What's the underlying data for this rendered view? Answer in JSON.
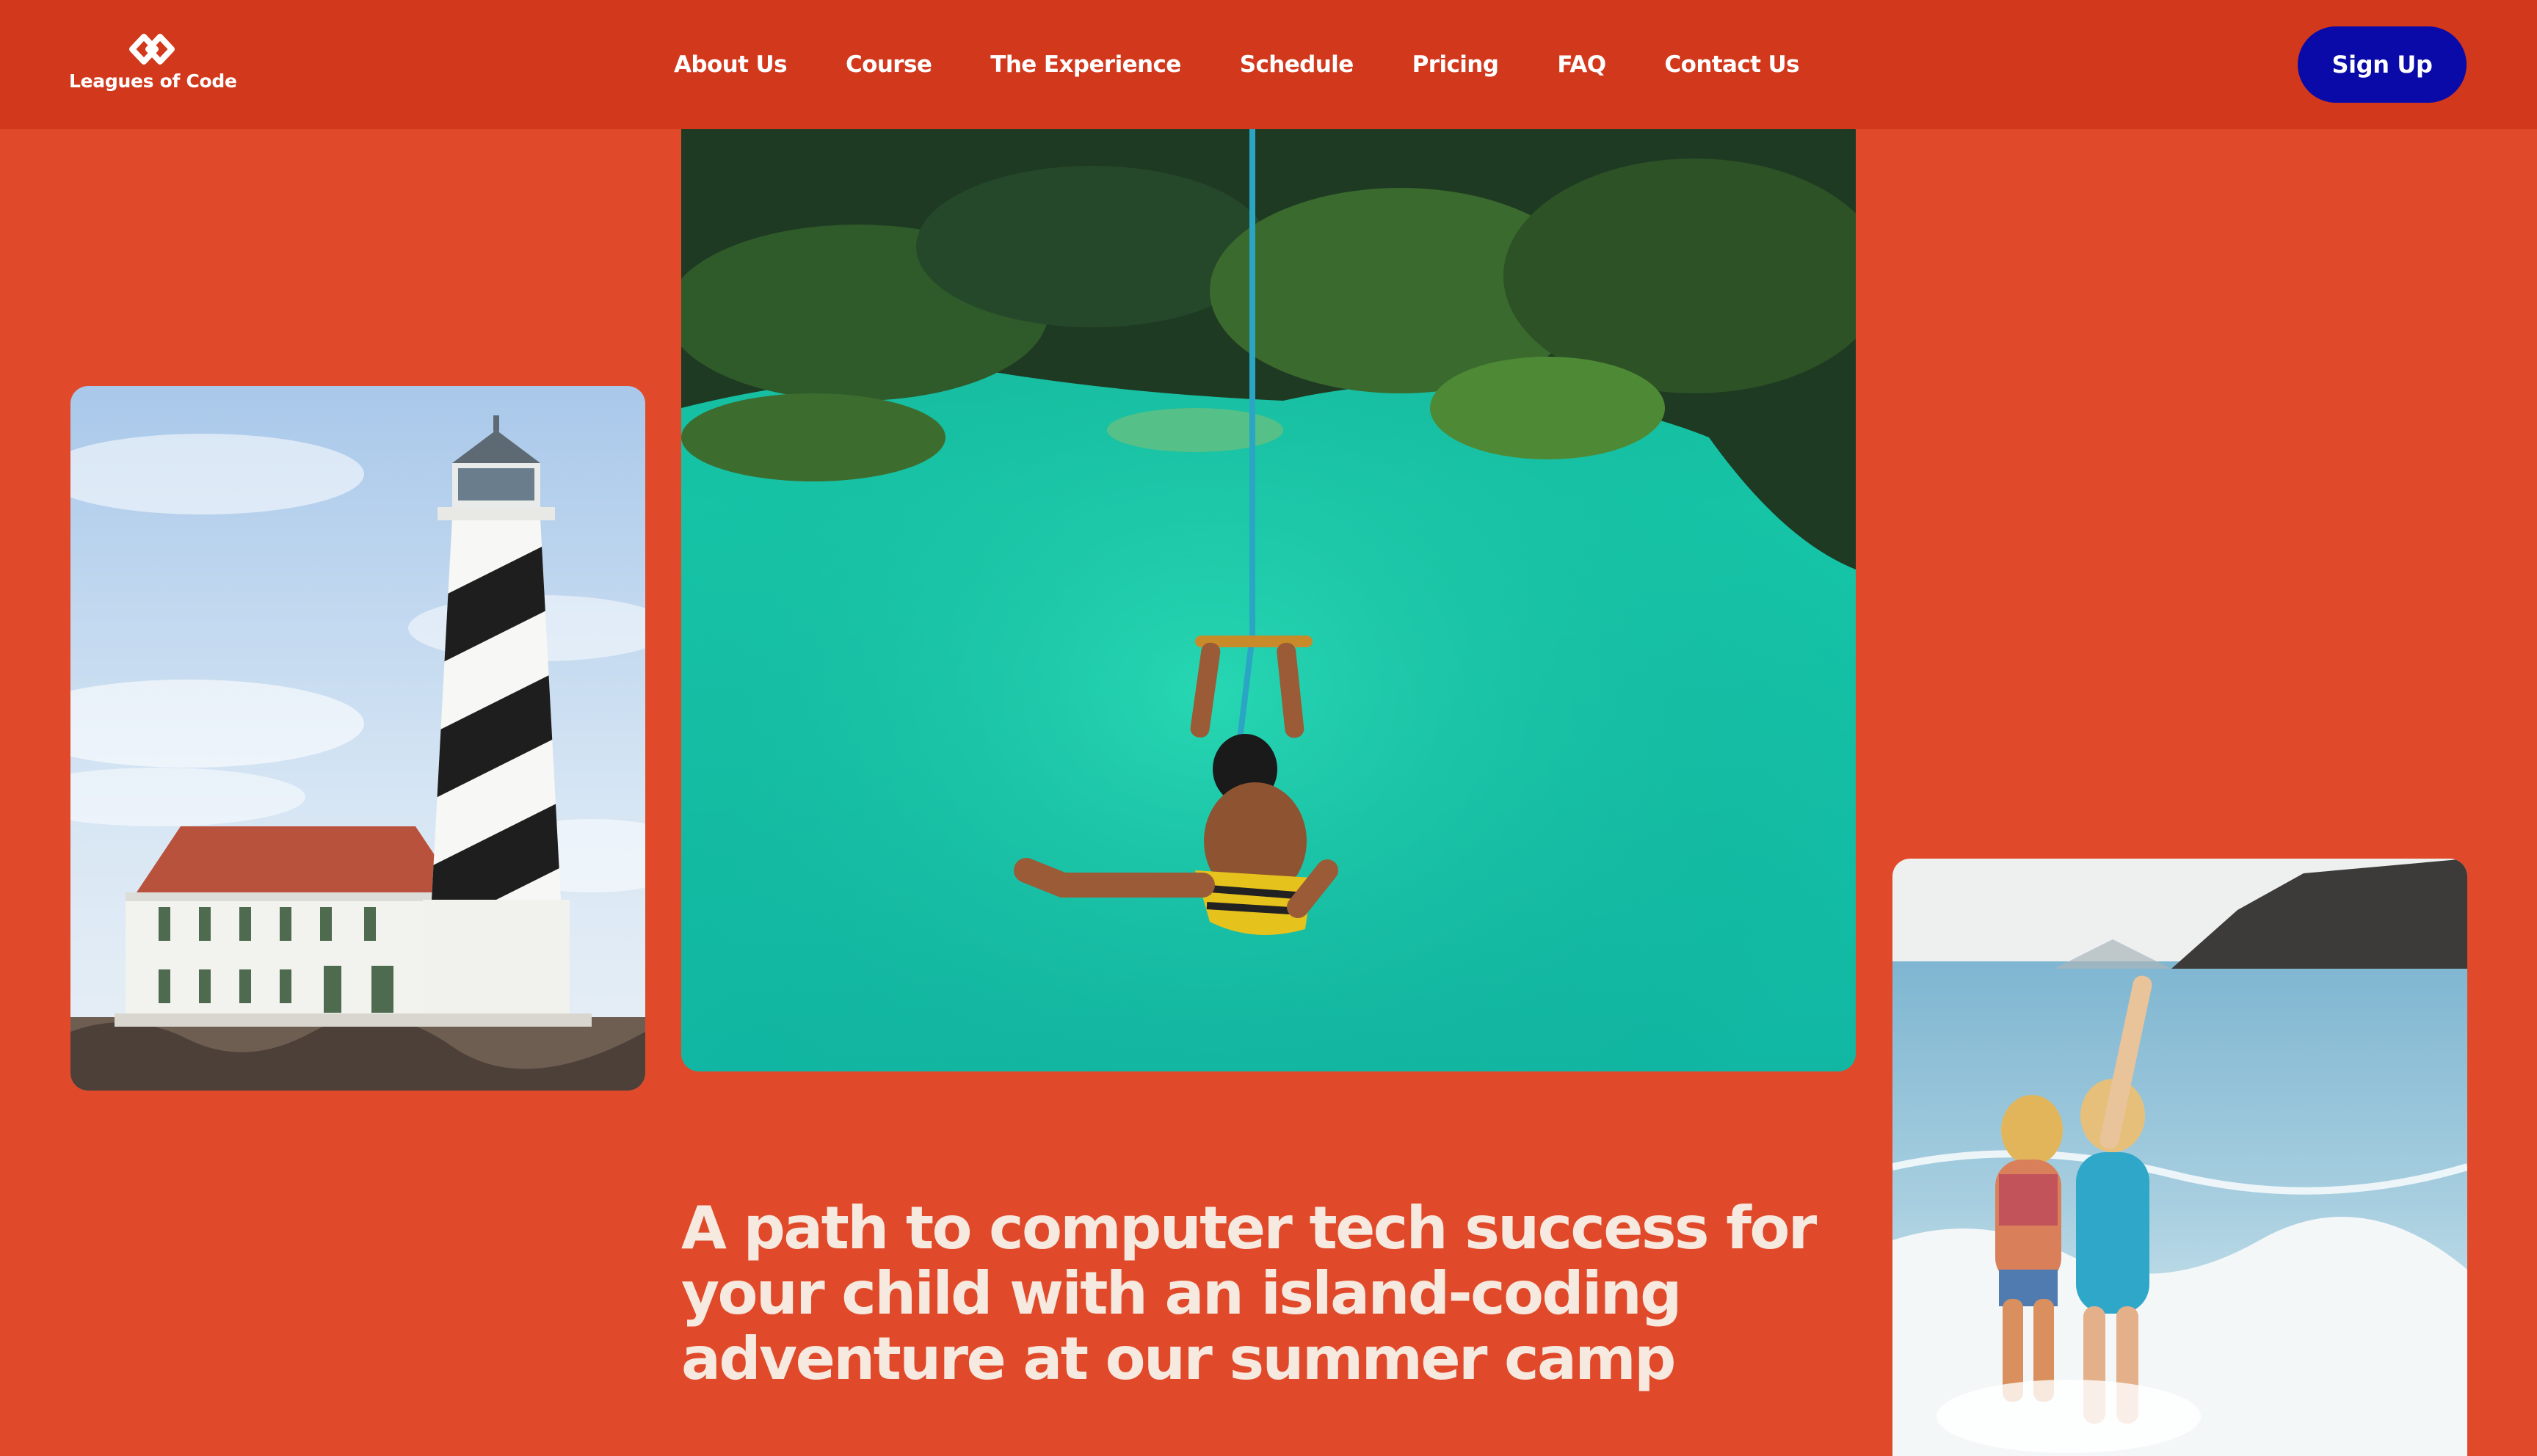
{
  "brand": {
    "name": "Leagues of Code",
    "logo_icon": "linked-diamonds-logo-icon"
  },
  "nav": {
    "items": [
      {
        "label": "About Us"
      },
      {
        "label": "Course"
      },
      {
        "label": "The Experience"
      },
      {
        "label": "Schedule"
      },
      {
        "label": "Pricing"
      },
      {
        "label": "FAQ"
      },
      {
        "label": "Contact Us"
      }
    ]
  },
  "header": {
    "signup_label": "Sign Up"
  },
  "hero": {
    "headline": "A path to computer tech success for your child with an island-coding adventure at our summer camp"
  },
  "colors": {
    "background": "#e04a2b",
    "header_background": "#d1381c",
    "signup_button": "#0a0aa8",
    "headline_text": "#f6e9df"
  }
}
